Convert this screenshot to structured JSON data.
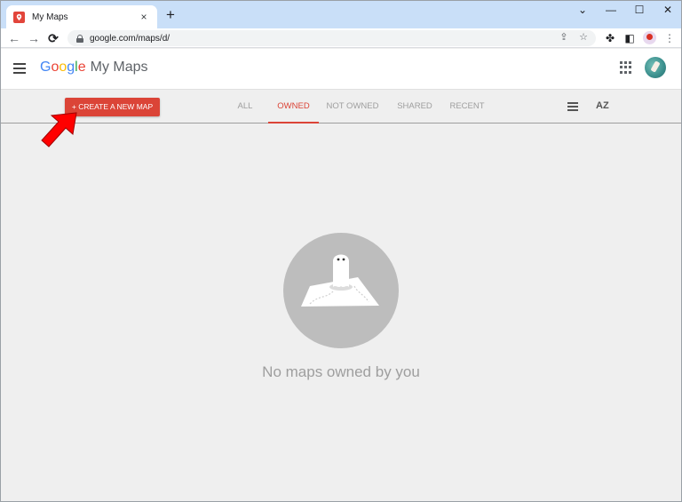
{
  "browser": {
    "tab_title": "My Maps",
    "tab_close": "×",
    "new_tab": "+",
    "window_controls": [
      "⌄",
      "—",
      "☐",
      "✕"
    ],
    "url": "google.com/maps/d/",
    "nav": {
      "back": "←",
      "forward": "→",
      "reload": "⟳"
    },
    "toolbar_icons": [
      "share-icon",
      "star-icon",
      "extensions-icon",
      "sidebar-icon",
      "profile-icon",
      "menu-icon"
    ]
  },
  "app": {
    "logo_google": "Google",
    "logo_product": "My Maps",
    "brand_colors": [
      "#4285F4",
      "#EA4335",
      "#FBBC05",
      "#4285F4",
      "#34A853",
      "#EA4335"
    ]
  },
  "filter_bar": {
    "create_button": "+ CREATE A NEW MAP",
    "tabs": [
      {
        "label": "ALL",
        "active": false
      },
      {
        "label": "OWNED",
        "active": true
      },
      {
        "label": "NOT OWNED",
        "active": false
      },
      {
        "label": "SHARED",
        "active": false
      },
      {
        "label": "RECENT",
        "active": false
      }
    ],
    "sort_label": "AZ"
  },
  "empty_state": {
    "message": "No maps owned by you"
  },
  "colors": {
    "accent": "#db4437",
    "background": "#efefef",
    "tabstrip": "#c9dff8"
  }
}
